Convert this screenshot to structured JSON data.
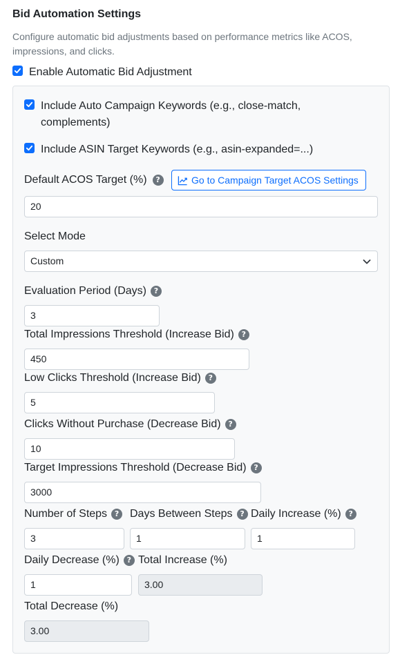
{
  "section": {
    "title": "Bid Automation Settings",
    "description": "Configure automatic bid adjustments based on performance metrics like ACOS, impressions, and clicks."
  },
  "enable_auto": {
    "label": "Enable Automatic Bid Adjustment",
    "checked": true
  },
  "options": {
    "auto_campaign": {
      "label": "Include Auto Campaign Keywords (e.g., close-match, complements)",
      "checked": true
    },
    "asin_target": {
      "label": "Include ASIN Target Keywords (e.g., asin-expanded=...)",
      "checked": true
    }
  },
  "acos": {
    "label": "Default ACOS Target (%)",
    "button_label": "Go to Campaign Target ACOS Settings",
    "value": "20"
  },
  "mode": {
    "label": "Select Mode",
    "value": "Custom"
  },
  "fields": {
    "evaluation_period": {
      "label": "Evaluation Period (Days)",
      "value": "3"
    },
    "total_impressions": {
      "label": "Total Impressions Threshold (Increase Bid)",
      "value": "450"
    },
    "low_clicks": {
      "label": "Low Clicks Threshold (Increase Bid)",
      "value": "5"
    },
    "clicks_without_purchase": {
      "label": "Clicks Without Purchase (Decrease Bid)",
      "value": "10"
    },
    "target_impressions": {
      "label": "Target Impressions Threshold (Decrease Bid)",
      "value": "3000"
    },
    "number_of_steps": {
      "label": "Number of Steps",
      "value": "3"
    },
    "days_between_steps": {
      "label": "Days Between Steps",
      "value": "1"
    },
    "daily_increase": {
      "label": "Daily Increase (%)",
      "value": "1"
    },
    "daily_decrease": {
      "label": "Daily Decrease (%)",
      "value": "1"
    },
    "total_increase": {
      "label": "Total Increase (%)",
      "value": "3.00"
    },
    "total_decrease": {
      "label": "Total Decrease (%)",
      "value": "3.00"
    }
  },
  "help_glyph": "?",
  "colors": {
    "primary": "#0d6efd",
    "muted": "#6c757d",
    "panel_bg": "#f8f9fa",
    "readonly_bg": "#e9ecef"
  }
}
